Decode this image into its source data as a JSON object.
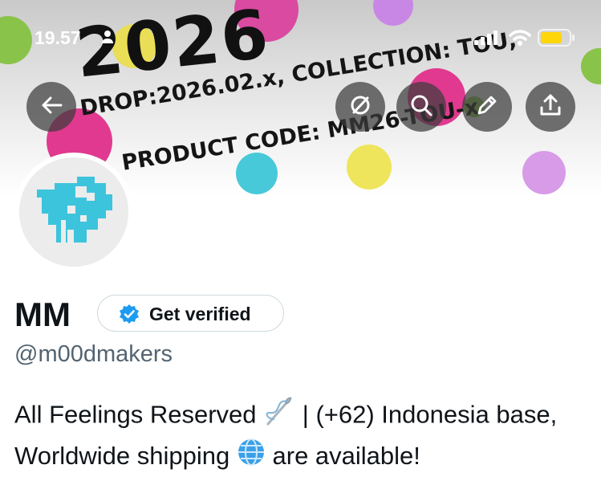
{
  "status_bar": {
    "time": "19.57",
    "battery_color": "#ffd60a"
  },
  "banner": {
    "headline": "2026",
    "drop_text": "DROP:2026.02.x, COLLECTION: TOU,",
    "code_text": "PRODUCT CODE: MM26-TOU-x",
    "dot_colors": [
      "#e0398f",
      "#8ac34a",
      "#c987e5",
      "#e9de55",
      "#48c9d9"
    ]
  },
  "nav": {
    "back_icon": "arrow-left-icon",
    "actions": [
      "grok-icon",
      "search-icon",
      "edit-icon",
      "share-icon"
    ]
  },
  "profile": {
    "display_name": "MM",
    "verify_button_label": "Get verified",
    "handle": "@m00dmakers",
    "bio_part1": "All Feelings Reserved",
    "bio_part2": "| (+62) Indonesia base, Worldwide shipping",
    "bio_part3": "are available!",
    "accent_color": "#1d9bf0"
  }
}
